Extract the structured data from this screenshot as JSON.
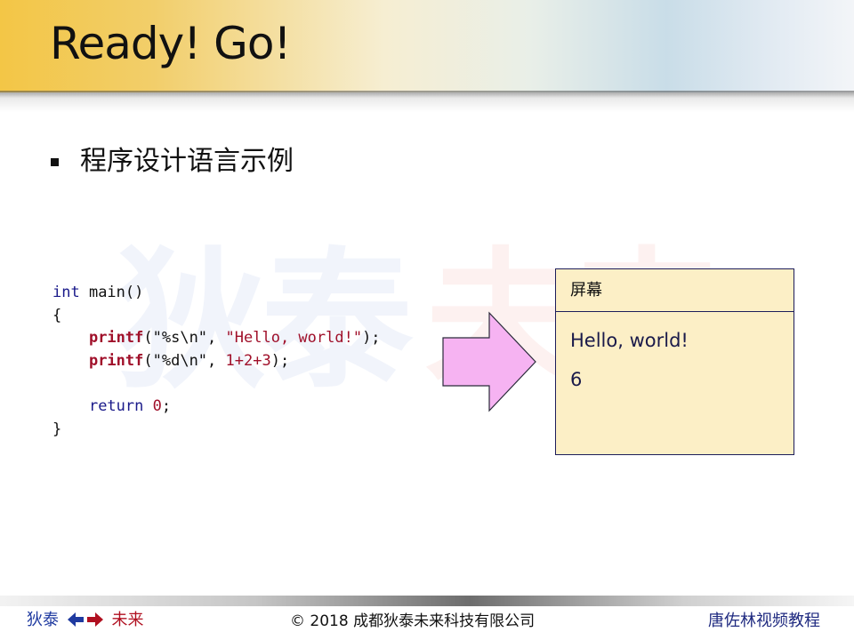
{
  "slide": {
    "title": "Ready! Go!",
    "bullet": "程序设计语言示例"
  },
  "watermark": {
    "left": "狄泰",
    "right": "未来"
  },
  "code": {
    "line1_kw": "int",
    "line1_rest": " main()",
    "line2": "{",
    "line3_fn": "printf",
    "line3_a": "(",
    "line3_fmt": "\"%s\\n\"",
    "line3_sep": ", ",
    "line3_str": "\"Hello, world!\"",
    "line3_end": ");",
    "line4_fn": "printf",
    "line4_a": "(",
    "line4_fmt": "\"%d\\n\"",
    "line4_sep": ", ",
    "line4_expr": "1+2+3",
    "line4_end": ");",
    "line6_kw": "return",
    "line6_sp": " ",
    "line6_num": "0",
    "line6_end": ";",
    "line7": "}"
  },
  "screen": {
    "title": "屏幕",
    "output": [
      "Hello, world!",
      "6"
    ]
  },
  "footer": {
    "left_a": "狄泰",
    "left_b": "未来",
    "center": "© 2018 成都狄泰未来科技有限公司",
    "right": "唐佐林视频教程"
  },
  "colors": {
    "arrow_fill": "#f6b3f2",
    "screen_bg": "#fcefc6",
    "code_keyword": "#1a1a8a",
    "code_accent": "#a0102a"
  },
  "icons": {
    "bullet": "square-bullet-icon",
    "arrow": "right-arrow-icon",
    "footer": "left-right-arrows-icon"
  }
}
